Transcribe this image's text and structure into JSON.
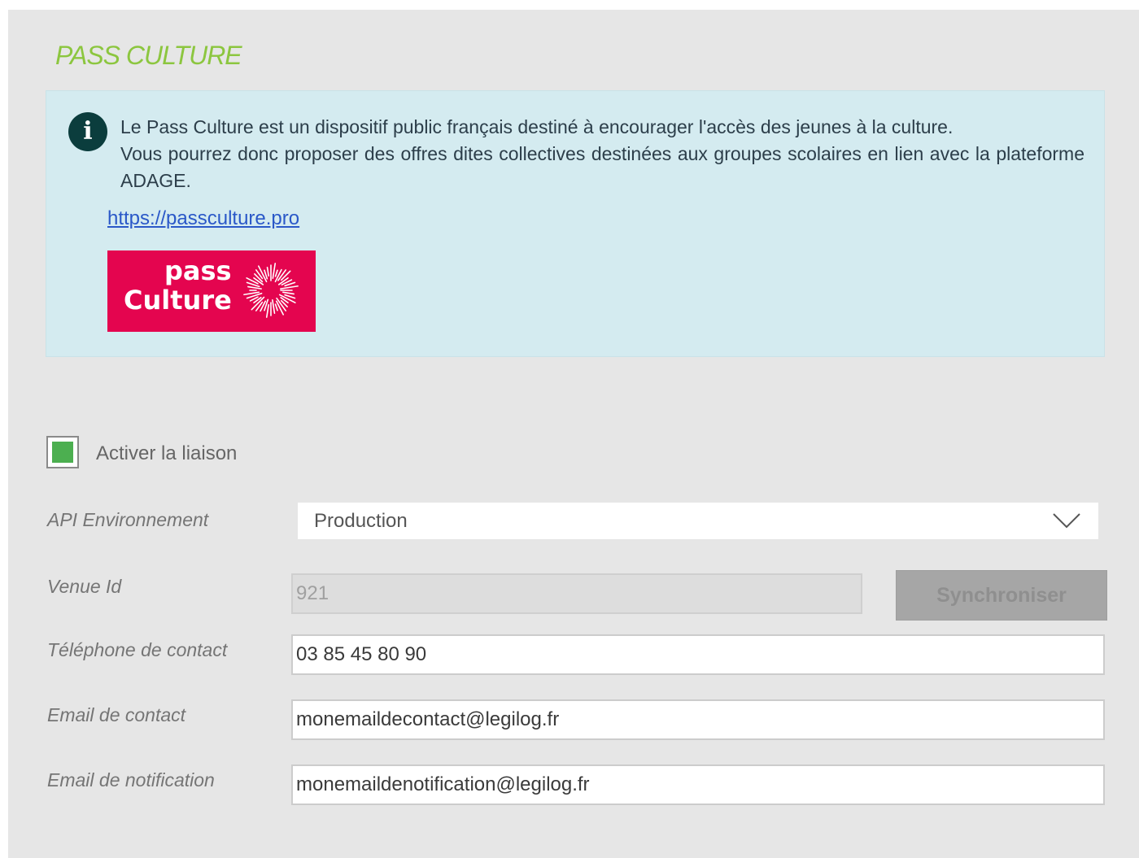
{
  "section": {
    "title": "PASS CULTURE"
  },
  "info": {
    "icon": "info-icon",
    "line1": "Le Pass Culture est un dispositif public français destiné à encourager l'accès des jeunes à la culture.",
    "line2": "Vous pourrez donc proposer des offres dites collectives destinées aux groupes scolaires en lien avec la plateforme ADAGE.",
    "link": "https://passculture.pro",
    "logo": {
      "word1": "pass",
      "word2": "Culture",
      "color": "#e4054f"
    }
  },
  "activation": {
    "label": "Activer la liaison",
    "checked": true
  },
  "form": {
    "api_env": {
      "label": "API Environnement",
      "value": "Production"
    },
    "venue_id": {
      "label": "Venue Id",
      "value": "921",
      "sync_button": "Synchroniser"
    },
    "phone": {
      "label": "Téléphone de contact",
      "value": "03 85 45 80 90"
    },
    "email_contact": {
      "label": "Email de contact",
      "value": "monemaildecontact@legilog.fr"
    },
    "email_notification": {
      "label": "Email de notification",
      "value": "monemaildenotification@legilog.fr"
    }
  },
  "colors": {
    "accent_green": "#8cc63f",
    "checkbox_green": "#4caf50",
    "info_background": "#d4ebf0",
    "link_blue": "#2a58c8"
  }
}
